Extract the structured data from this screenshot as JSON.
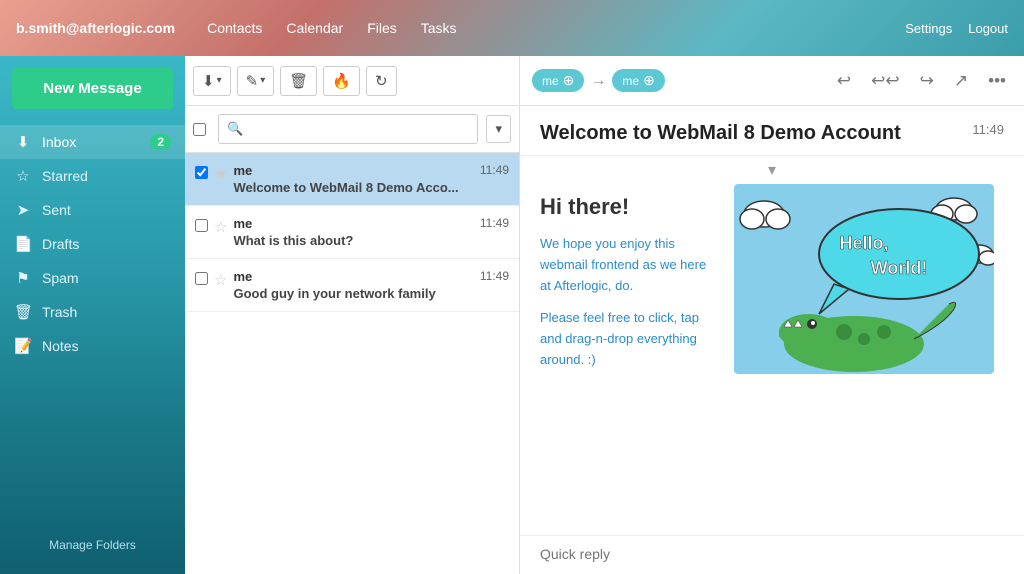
{
  "header": {
    "user_email": "b.smith@afterlogic.com",
    "nav": [
      "Contacts",
      "Calendar",
      "Files",
      "Tasks"
    ],
    "settings_label": "Settings",
    "logout_label": "Logout"
  },
  "sidebar": {
    "new_message_label": "New Message",
    "items": [
      {
        "id": "inbox",
        "label": "Inbox",
        "icon": "📥",
        "badge": 2,
        "active": true
      },
      {
        "id": "starred",
        "label": "Starred",
        "icon": "☆",
        "badge": null,
        "active": false
      },
      {
        "id": "sent",
        "label": "Sent",
        "icon": "➤",
        "badge": null,
        "active": false
      },
      {
        "id": "drafts",
        "label": "Drafts",
        "icon": "📄",
        "badge": null,
        "active": false
      },
      {
        "id": "spam",
        "label": "Spam",
        "icon": "⚠",
        "badge": null,
        "active": false
      },
      {
        "id": "trash",
        "label": "Trash",
        "icon": "🗑",
        "badge": null,
        "active": false
      },
      {
        "id": "notes",
        "label": "Notes",
        "icon": "📝",
        "badge": null,
        "active": false
      }
    ],
    "manage_folders_label": "Manage Folders"
  },
  "email_list": {
    "search_placeholder": "",
    "emails": [
      {
        "id": 1,
        "from": "me",
        "time": "11:49",
        "subject": "Welcome to WebMail 8 Demo Acco...",
        "selected": true
      },
      {
        "id": 2,
        "from": "me",
        "time": "11:49",
        "subject": "What is this about?",
        "selected": false
      },
      {
        "id": 3,
        "from": "me",
        "time": "11:49",
        "subject": "Good guy in your network family",
        "selected": false
      }
    ]
  },
  "email_view": {
    "from_badge": "me",
    "to_badge": "me",
    "subject": "Welcome to WebMail 8 Demo Account",
    "time": "11:49",
    "hi_there": "Hi there!",
    "body_para1": "We hope you enjoy this webmail frontend as we here at Afterlogic, do.",
    "body_para2": "Please feel free to click, tap and drag-n-drop everything around. :)",
    "quick_reply_placeholder": "Quick reply"
  }
}
